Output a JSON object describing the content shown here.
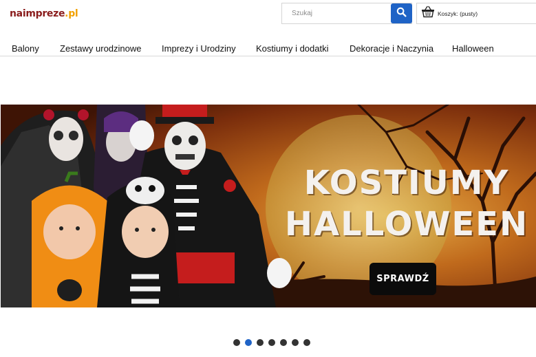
{
  "header": {
    "logo_part1": "naimpreze",
    "logo_part2": ".pl",
    "search_placeholder": "Szukaj",
    "cart_label": "Koszyk: (pusty)"
  },
  "nav": {
    "items": [
      "Balony",
      "Zestawy urodzinowe",
      "Imprezy i Urodziny",
      "Kostiumy i dodatki",
      "Dekoracje i Naczynia",
      "Halloween"
    ]
  },
  "banner": {
    "title_line1": "KOSTIUMY",
    "title_line2": "HALLOWEEN",
    "cta_label": "SPRAWDŹ"
  },
  "carousel": {
    "slide_count": 7,
    "active_index": 1
  },
  "colors": {
    "accent": "#1f63c6",
    "logo_dark": "#8a1c1c",
    "logo_orange": "#f2a100"
  }
}
